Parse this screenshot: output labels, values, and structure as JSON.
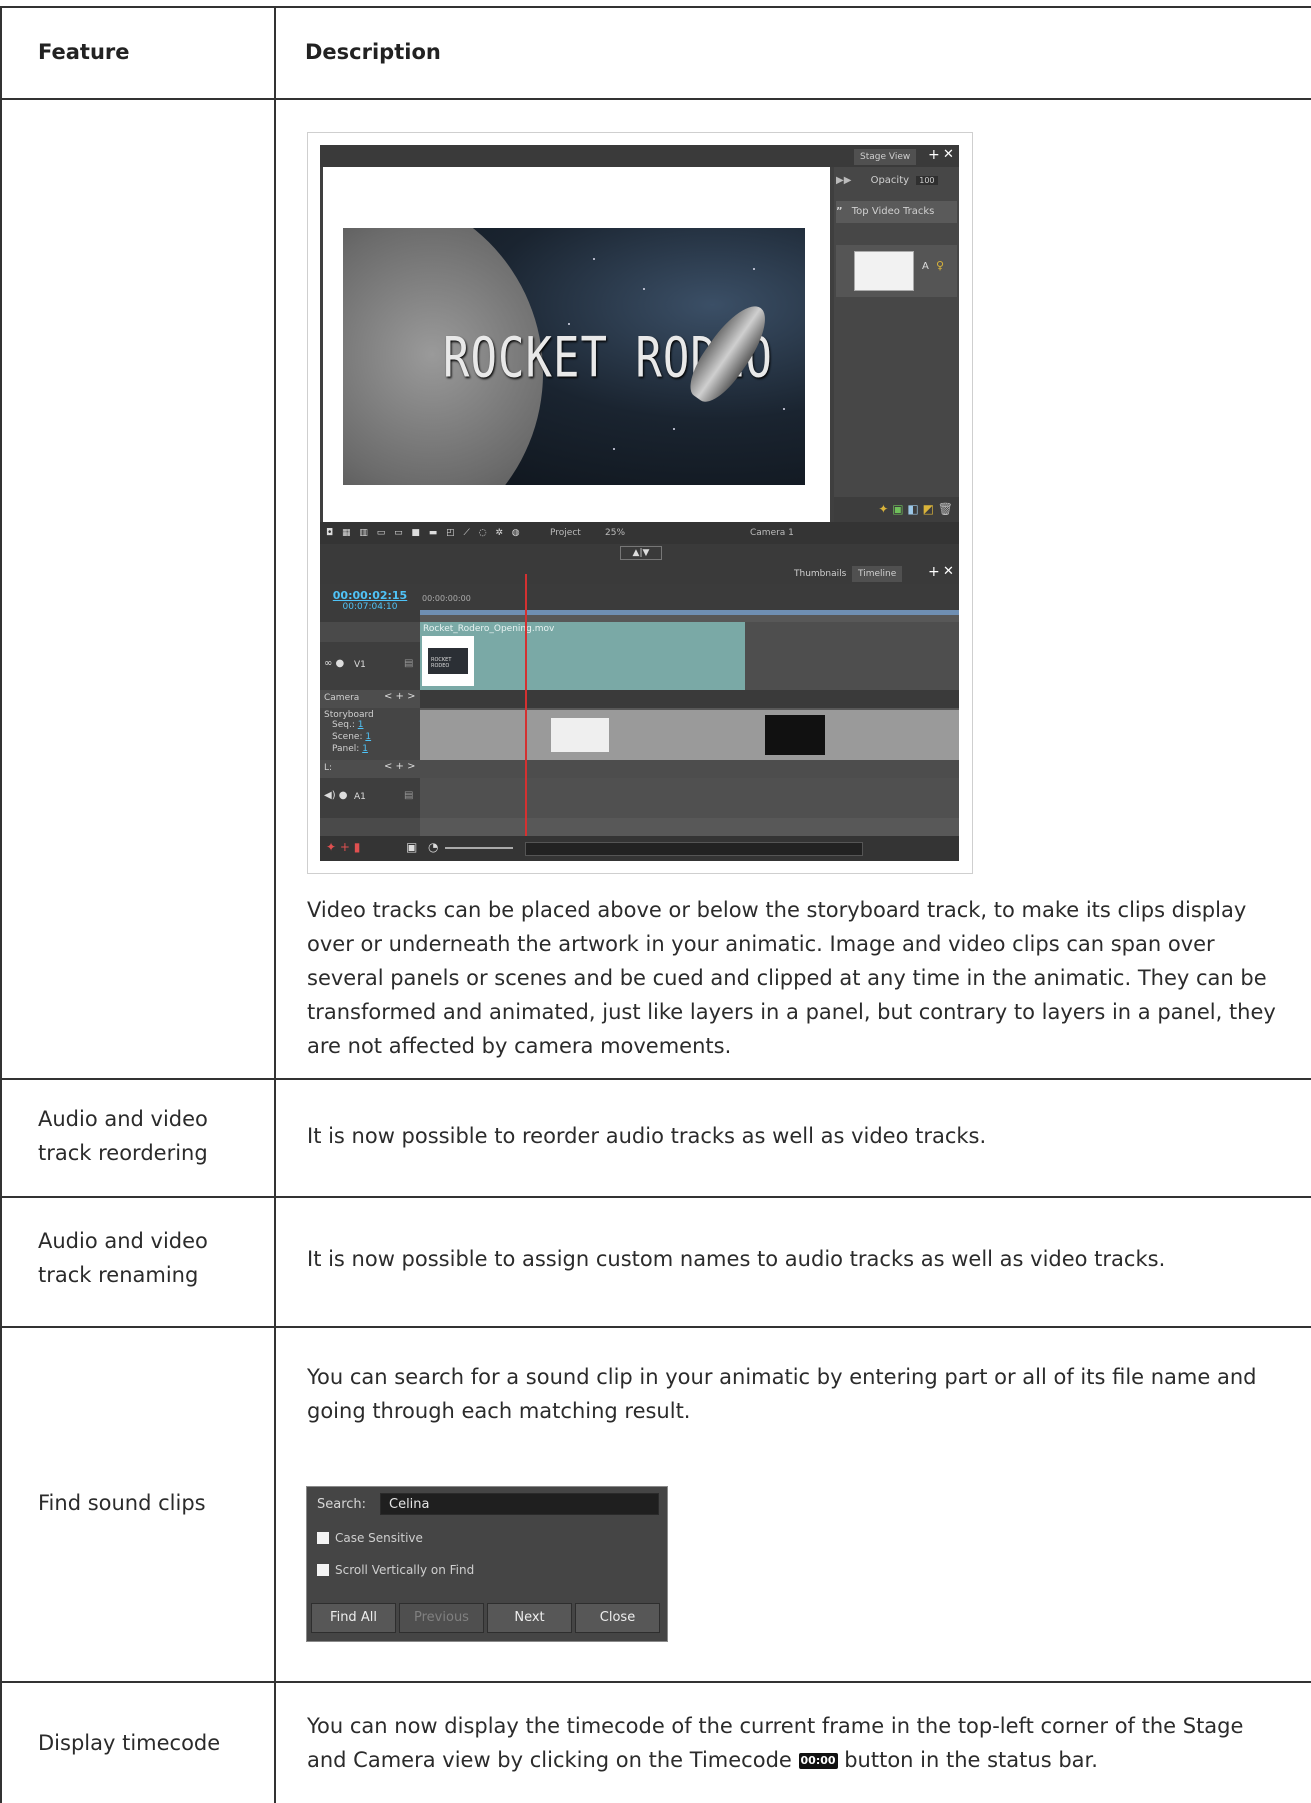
{
  "table": {
    "header": {
      "feature": "Feature",
      "description": "Description"
    },
    "rows": [
      {
        "feature": "",
        "description": "Video tracks can be placed above or below the storyboard track, to make its clips display over or underneath the artwork in your animatic. Image and video clips can span over several panels or scenes and be cued and clipped at any time in the animatic. They can be transformed and animated, just like layers in a panel, but contrary to layers in a panel, they are not affected by camera movements."
      },
      {
        "feature": "Audio and video track reordering",
        "description": "It is now possible to reorder audio tracks as well as video tracks."
      },
      {
        "feature": "Audio and video track renaming",
        "description": "It is now possible to assign custom names to audio tracks as well as video tracks."
      },
      {
        "feature": "Find sound clips",
        "description": "You can search for a sound clip in your animatic by entering part or all of its file name and going through each matching result."
      },
      {
        "feature": "Display timecode",
        "description_before": "You can now display the timecode of the current frame in the top-left corner of the Stage and Camera view by clicking on the Timecode",
        "description_after": "button in the status bar.",
        "timecode_icon_text": "00:00"
      }
    ]
  },
  "storyboard_ui": {
    "stage_view_tab": "Stage View",
    "opacity_label": "Opacity",
    "opacity_value": "100",
    "top_video_tracks": "Top Video Tracks",
    "track_letter": "A",
    "title_art": "ROCKET RODEO",
    "status_project": "Project",
    "status_zoom": "25%",
    "status_camera": "Camera 1",
    "tab_thumbnails": "Thumbnails",
    "tab_timeline": "Timeline",
    "timecode_main": "00:00:02:15",
    "timecode_total": "00:07:04:10",
    "ruler_start": "00:00:00:00",
    "clip_name": "Rocket_Rodero_Opening.mov",
    "clip_thumb_text": "ROCKET RODEO",
    "track_v1": "V1",
    "track_camera": "Camera",
    "track_storyboard": "Storyboard",
    "seq_label": "Seq.:",
    "seq_value": "1",
    "scene_label": "Scene:",
    "scene_value": "1",
    "panel_label": "Panel:",
    "panel_value": "1",
    "track_l": "L:",
    "track_a1": "A1"
  },
  "find_dialog": {
    "search_label": "Search:",
    "search_value": "Celina",
    "case_sensitive": "Case Sensitive",
    "scroll_vertically": "Scroll Vertically on Find",
    "find_all": "Find All",
    "previous": "Previous",
    "next": "Next",
    "close": "Close"
  }
}
